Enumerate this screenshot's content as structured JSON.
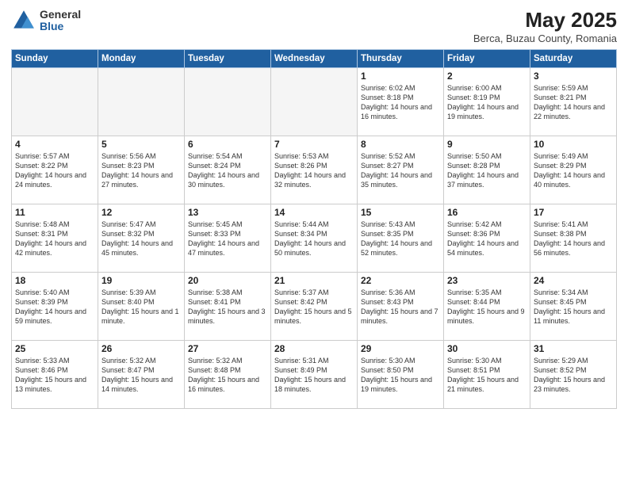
{
  "header": {
    "logo_general": "General",
    "logo_blue": "Blue",
    "title": "May 2025",
    "subtitle": "Berca, Buzau County, Romania"
  },
  "days_of_week": [
    "Sunday",
    "Monday",
    "Tuesday",
    "Wednesday",
    "Thursday",
    "Friday",
    "Saturday"
  ],
  "weeks": [
    [
      {
        "day": "",
        "empty": true
      },
      {
        "day": "",
        "empty": true
      },
      {
        "day": "",
        "empty": true
      },
      {
        "day": "",
        "empty": true
      },
      {
        "day": "1",
        "sunrise": "6:02 AM",
        "sunset": "8:18 PM",
        "daylight": "14 hours and 16 minutes."
      },
      {
        "day": "2",
        "sunrise": "6:00 AM",
        "sunset": "8:19 PM",
        "daylight": "14 hours and 19 minutes."
      },
      {
        "day": "3",
        "sunrise": "5:59 AM",
        "sunset": "8:21 PM",
        "daylight": "14 hours and 22 minutes."
      }
    ],
    [
      {
        "day": "4",
        "sunrise": "5:57 AM",
        "sunset": "8:22 PM",
        "daylight": "14 hours and 24 minutes."
      },
      {
        "day": "5",
        "sunrise": "5:56 AM",
        "sunset": "8:23 PM",
        "daylight": "14 hours and 27 minutes."
      },
      {
        "day": "6",
        "sunrise": "5:54 AM",
        "sunset": "8:24 PM",
        "daylight": "14 hours and 30 minutes."
      },
      {
        "day": "7",
        "sunrise": "5:53 AM",
        "sunset": "8:26 PM",
        "daylight": "14 hours and 32 minutes."
      },
      {
        "day": "8",
        "sunrise": "5:52 AM",
        "sunset": "8:27 PM",
        "daylight": "14 hours and 35 minutes."
      },
      {
        "day": "9",
        "sunrise": "5:50 AM",
        "sunset": "8:28 PM",
        "daylight": "14 hours and 37 minutes."
      },
      {
        "day": "10",
        "sunrise": "5:49 AM",
        "sunset": "8:29 PM",
        "daylight": "14 hours and 40 minutes."
      }
    ],
    [
      {
        "day": "11",
        "sunrise": "5:48 AM",
        "sunset": "8:31 PM",
        "daylight": "14 hours and 42 minutes."
      },
      {
        "day": "12",
        "sunrise": "5:47 AM",
        "sunset": "8:32 PM",
        "daylight": "14 hours and 45 minutes."
      },
      {
        "day": "13",
        "sunrise": "5:45 AM",
        "sunset": "8:33 PM",
        "daylight": "14 hours and 47 minutes."
      },
      {
        "day": "14",
        "sunrise": "5:44 AM",
        "sunset": "8:34 PM",
        "daylight": "14 hours and 50 minutes."
      },
      {
        "day": "15",
        "sunrise": "5:43 AM",
        "sunset": "8:35 PM",
        "daylight": "14 hours and 52 minutes."
      },
      {
        "day": "16",
        "sunrise": "5:42 AM",
        "sunset": "8:36 PM",
        "daylight": "14 hours and 54 minutes."
      },
      {
        "day": "17",
        "sunrise": "5:41 AM",
        "sunset": "8:38 PM",
        "daylight": "14 hours and 56 minutes."
      }
    ],
    [
      {
        "day": "18",
        "sunrise": "5:40 AM",
        "sunset": "8:39 PM",
        "daylight": "14 hours and 59 minutes."
      },
      {
        "day": "19",
        "sunrise": "5:39 AM",
        "sunset": "8:40 PM",
        "daylight": "15 hours and 1 minute."
      },
      {
        "day": "20",
        "sunrise": "5:38 AM",
        "sunset": "8:41 PM",
        "daylight": "15 hours and 3 minutes."
      },
      {
        "day": "21",
        "sunrise": "5:37 AM",
        "sunset": "8:42 PM",
        "daylight": "15 hours and 5 minutes."
      },
      {
        "day": "22",
        "sunrise": "5:36 AM",
        "sunset": "8:43 PM",
        "daylight": "15 hours and 7 minutes."
      },
      {
        "day": "23",
        "sunrise": "5:35 AM",
        "sunset": "8:44 PM",
        "daylight": "15 hours and 9 minutes."
      },
      {
        "day": "24",
        "sunrise": "5:34 AM",
        "sunset": "8:45 PM",
        "daylight": "15 hours and 11 minutes."
      }
    ],
    [
      {
        "day": "25",
        "sunrise": "5:33 AM",
        "sunset": "8:46 PM",
        "daylight": "15 hours and 13 minutes."
      },
      {
        "day": "26",
        "sunrise": "5:32 AM",
        "sunset": "8:47 PM",
        "daylight": "15 hours and 14 minutes."
      },
      {
        "day": "27",
        "sunrise": "5:32 AM",
        "sunset": "8:48 PM",
        "daylight": "15 hours and 16 minutes."
      },
      {
        "day": "28",
        "sunrise": "5:31 AM",
        "sunset": "8:49 PM",
        "daylight": "15 hours and 18 minutes."
      },
      {
        "day": "29",
        "sunrise": "5:30 AM",
        "sunset": "8:50 PM",
        "daylight": "15 hours and 19 minutes."
      },
      {
        "day": "30",
        "sunrise": "5:30 AM",
        "sunset": "8:51 PM",
        "daylight": "15 hours and 21 minutes."
      },
      {
        "day": "31",
        "sunrise": "5:29 AM",
        "sunset": "8:52 PM",
        "daylight": "15 hours and 23 minutes."
      }
    ]
  ]
}
